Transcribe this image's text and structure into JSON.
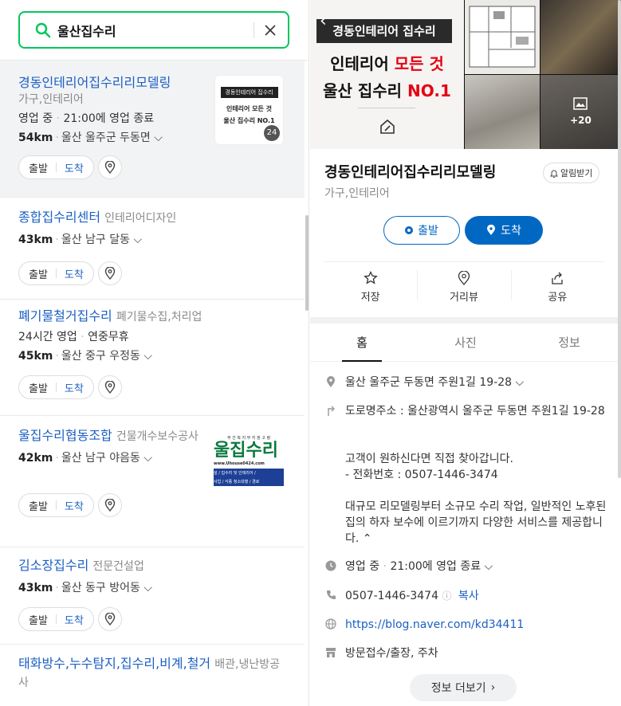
{
  "search": {
    "query": "울산집수리"
  },
  "results": [
    {
      "name": "경동인테리어집수리리모델링",
      "category": "가구,인테리어",
      "status": "영업 중",
      "hours": "21:00에 영업 종료",
      "distance": "54km",
      "address": "울산 울주군 두동면",
      "depart": "출발",
      "arrive": "도착",
      "thumb_lines": [
        "경동인테리어 집수리",
        "인테리어 모든 것",
        "울산 집수리 NO.1"
      ],
      "thumb_count": "24"
    },
    {
      "name": "종합집수리센터",
      "category": "인테리어디자인",
      "distance": "43km",
      "address": "울산 남구 달동",
      "depart": "출발",
      "arrive": "도착"
    },
    {
      "name": "폐기물철거집수리",
      "category": "폐기물수집,처리업",
      "info1": "24시간 영업",
      "info2": "연중무휴",
      "distance": "45km",
      "address": "울산 중구 우정동",
      "depart": "출발",
      "arrive": "도착"
    },
    {
      "name": "울집수리협동조합",
      "category": "건물개수보수공사",
      "distance": "42km",
      "address": "울산 남구 야음동",
      "depart": "출발",
      "arrive": "도착",
      "thumb_lines": [
        "부 건 복 지 부 지 정 고 령",
        "울집수리",
        "www.Uhouse0424.com",
        "설 / 집수리 및 인테리어 /",
        "사업 / 각종 청소대행 / 경로"
      ]
    },
    {
      "name": "김소장집수리",
      "category": "전문건설업",
      "distance": "43km",
      "address": "울산 동구 방어동",
      "depart": "출발",
      "arrive": "도착"
    },
    {
      "name": "태화방수,누수탐지,집수리,비계,철거",
      "category": "배관,냉난방공사"
    }
  ],
  "detail": {
    "hero_lines": [
      "경동인테리어 집수리",
      "인테리어",
      "모든 것",
      "울산 집수리",
      "NO.1"
    ],
    "photo_count": "+20",
    "name": "경동인테리어집수리리모델링",
    "category": "가구,인테리어",
    "alarm": "알림받기",
    "depart": "출발",
    "arrive": "도착",
    "tools": [
      "저장",
      "거리뷰",
      "공유"
    ],
    "tabs": [
      "홈",
      "사진",
      "정보"
    ],
    "address": "울산 울주군 두동면 주원1길 19-28",
    "road_address": "도로명주소 : 울산광역시 울주군 두동면 주원1길 19-28",
    "desc1": "고객이 원하신다면 직접 찾아갑니다.",
    "desc2": "- 전화번호 : 0507-1446-3474",
    "desc3": "대규모 리모델링부터 소규모 수리 작업, 일반적인 노후된 집의 하자 보수에 이르기까지 다양한 서비스를 제공합니다.",
    "status": "영업 중",
    "hours": "21:00에 영업 종료",
    "phone": "0507-1446-3474",
    "copy": "복사",
    "website": "https://blog.naver.com/kd34411",
    "amenities": "방문접수/출장, 주차",
    "more_info": "정보 더보기"
  },
  "colors": {
    "accent": "#03c75a",
    "link": "#1b5fc3",
    "primary": "#0068c3",
    "hero_red": "#e60012"
  }
}
